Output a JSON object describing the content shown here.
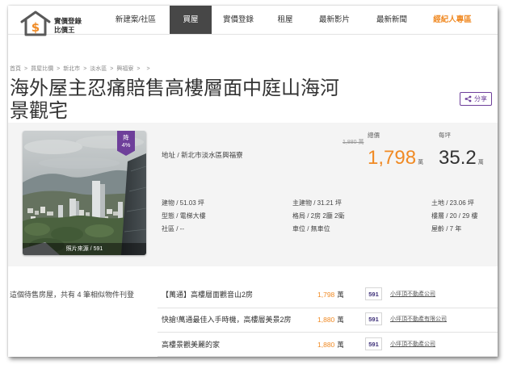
{
  "theme": {
    "accent": "#f08a24",
    "brand": "#6e3f9a",
    "nav_active_bg": "#474747"
  },
  "logo": {
    "icon": "house-dollar-icon",
    "symbol": "$",
    "line1": "實價登錄",
    "line2": "比價王"
  },
  "nav": [
    {
      "label": "新建案/社區",
      "active": false,
      "highlight": false
    },
    {
      "label": "買屋",
      "active": true,
      "highlight": false
    },
    {
      "label": "實價登錄",
      "active": false,
      "highlight": false
    },
    {
      "label": "租屋",
      "active": false,
      "highlight": false
    },
    {
      "label": "最新影片",
      "active": false,
      "highlight": false
    },
    {
      "label": "最新新聞",
      "active": false,
      "highlight": false
    },
    {
      "label": "經紀人專區",
      "active": false,
      "highlight": true
    }
  ],
  "breadcrumb": {
    "separator": ">",
    "items": [
      "首頁",
      "買屋比價",
      "新北市",
      "淡水區",
      "興福寮",
      "",
      ""
    ]
  },
  "listing": {
    "title": "海外屋主忍痛賠售高樓層面中庭山海河景觀宅",
    "share": {
      "label": "分享",
      "icon": "share-icon"
    },
    "photo": {
      "badge_label": "降",
      "badge_value": "4%",
      "caption": "照片來源 / 591"
    },
    "field_separator": " / ",
    "address": {
      "label": "地址",
      "value": "新北市淡水區興福寮"
    },
    "price": {
      "total_label": "總價",
      "original": "1,880 萬",
      "value": "1,798",
      "unit": "萬",
      "per_ping_label": "每坪",
      "per_ping_value": "35.2",
      "per_ping_unit": "萬"
    },
    "details": [
      [
        {
          "label": "建物",
          "value": "51.03 坪"
        },
        {
          "label": "主建物",
          "value": "31.21 坪"
        },
        {
          "label": "土地",
          "value": "23.06 坪"
        }
      ],
      [
        {
          "label": "型態",
          "value": "電梯大樓"
        },
        {
          "label": "格局",
          "value": "2房 2廳 2衛"
        },
        {
          "label": "樓層",
          "value": "20 / 29 樓"
        }
      ],
      [
        {
          "label": "社區",
          "value": "--"
        },
        {
          "label": "車位",
          "value": "無車位"
        },
        {
          "label": "屋齡",
          "value": "7 年"
        }
      ]
    ]
  },
  "similar": {
    "summary": "這個待售房屋，共有 4 筆相似物件刊登",
    "items": [
      {
        "title": "【萬通】高樓層面觀音山2房",
        "price": "1,798",
        "unit": "萬",
        "source": "591",
        "agent": "小坪頂不動產公司"
      },
      {
        "title": "快搶!萬通最佳入手時機，高樓層美景2房",
        "price": "1,880",
        "unit": "萬",
        "source": "591",
        "agent": "小坪頂不動產有限公司"
      },
      {
        "title": "高樓景觀美麗的家",
        "price": "1,880",
        "unit": "萬",
        "source": "591",
        "agent": "小坪頂不動產公司"
      }
    ]
  }
}
